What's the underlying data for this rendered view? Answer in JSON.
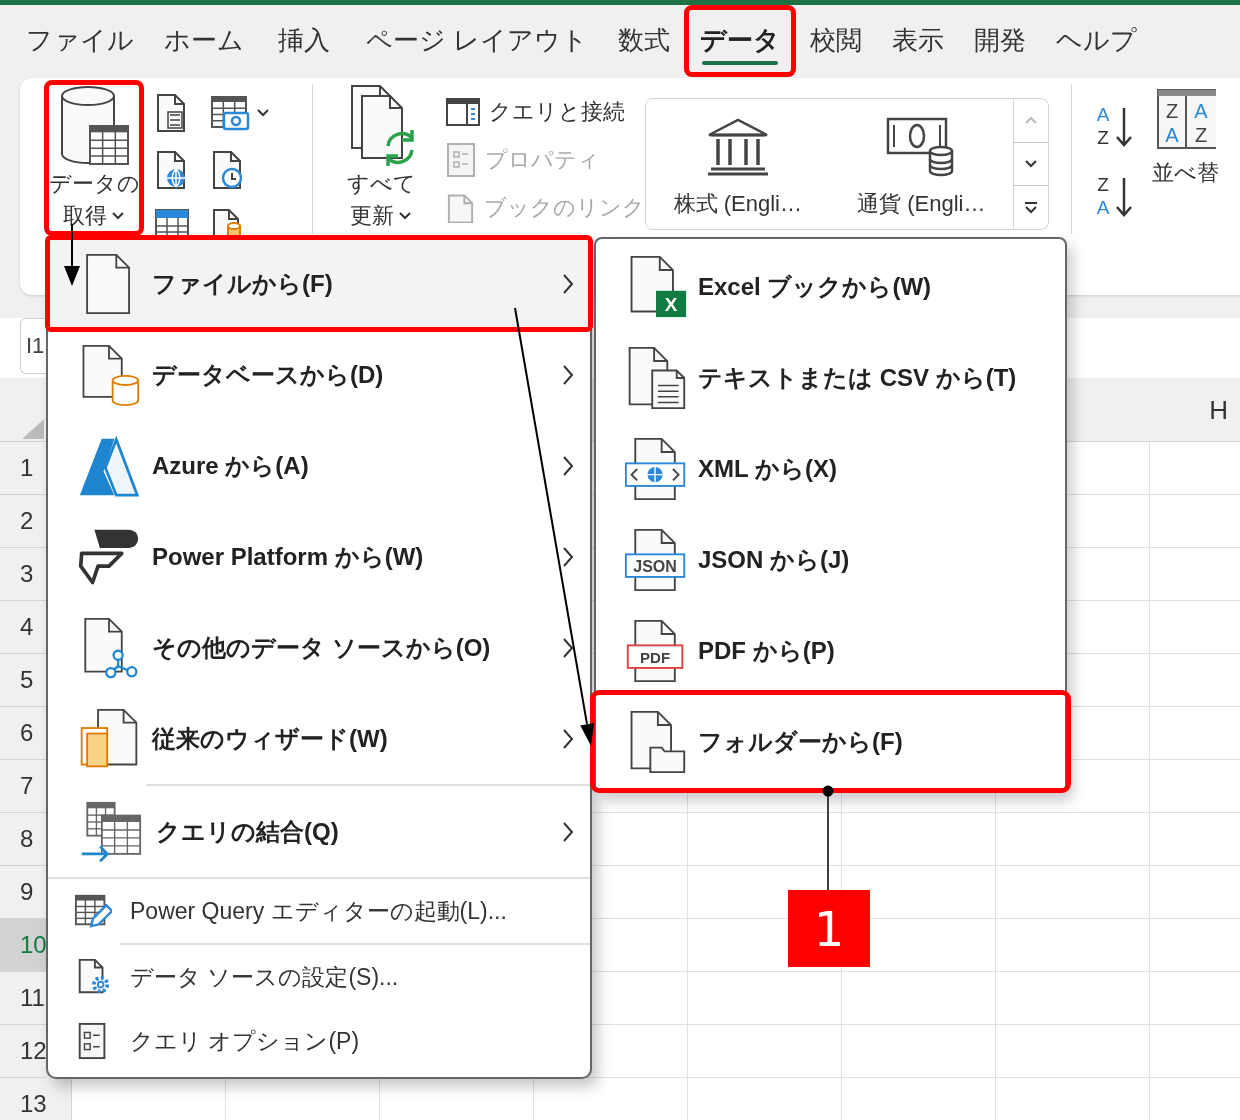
{
  "tabs": [
    {
      "label": "ファイル",
      "selected": false,
      "highlighted": false
    },
    {
      "label": "ホーム",
      "selected": false,
      "highlighted": false
    },
    {
      "label": "挿入",
      "selected": false,
      "highlighted": false
    },
    {
      "label": "ページ レイアウト",
      "selected": false,
      "highlighted": false
    },
    {
      "label": "数式",
      "selected": false,
      "highlighted": false
    },
    {
      "label": "データ",
      "selected": true,
      "highlighted": true
    },
    {
      "label": "校閲",
      "selected": false,
      "highlighted": false
    },
    {
      "label": "表示",
      "selected": false,
      "highlighted": false
    },
    {
      "label": "開発",
      "selected": false,
      "highlighted": false
    },
    {
      "label": "ヘルプ",
      "selected": false,
      "highlighted": false
    }
  ],
  "ribbon": {
    "get_data": {
      "label_lines": [
        "データの",
        "取得"
      ],
      "highlighted": true
    },
    "refresh_all": {
      "label_lines": [
        "すべて",
        "更新"
      ]
    },
    "query_commands": [
      {
        "label": "クエリと接続",
        "disabled": false
      },
      {
        "label": "プロパティ",
        "disabled": true
      },
      {
        "label": "ブックのリンク",
        "disabled": true
      }
    ],
    "data_types": [
      {
        "label": "株式 (Engli…"
      },
      {
        "label": "通貨 (Engli…"
      }
    ],
    "sort_buttons": [
      {
        "letters": [
          "A",
          "Z"
        ]
      },
      {
        "letters": [
          "Z",
          "A"
        ]
      }
    ],
    "sort": {
      "label": "並べ替",
      "icon_letters": [
        "Z",
        "A",
        "A",
        "Z"
      ]
    }
  },
  "name_box": {
    "value": "I1"
  },
  "sheet": {
    "column_headers": [
      "H"
    ],
    "rows": [
      {
        "label": "1",
        "selected": false
      },
      {
        "label": "2",
        "selected": false
      },
      {
        "label": "3",
        "selected": false
      },
      {
        "label": "4",
        "selected": false
      },
      {
        "label": "5",
        "selected": false
      },
      {
        "label": "6",
        "selected": false
      },
      {
        "label": "7",
        "selected": false
      },
      {
        "label": "8",
        "selected": false
      },
      {
        "label": "9",
        "selected": false
      },
      {
        "label": "10",
        "selected": true
      },
      {
        "label": "11",
        "selected": false
      },
      {
        "label": "12",
        "selected": false
      },
      {
        "label": "13",
        "selected": false
      }
    ]
  },
  "menu": {
    "items": [
      {
        "kind": "large",
        "label": "ファイルから(F)",
        "submenu": true,
        "selected": true,
        "highlighted": true,
        "separator_before": false
      },
      {
        "kind": "large",
        "label": "データベースから(D)",
        "submenu": true,
        "selected": false,
        "highlighted": false,
        "separator_before": false
      },
      {
        "kind": "large",
        "label": "Azure から(A)",
        "submenu": true,
        "selected": false,
        "highlighted": false,
        "separator_before": false
      },
      {
        "kind": "large",
        "label": "Power Platform から(W)",
        "submenu": true,
        "selected": false,
        "highlighted": false,
        "separator_before": false
      },
      {
        "kind": "large",
        "label": "その他のデータ ソースから(O)",
        "submenu": true,
        "selected": false,
        "highlighted": false,
        "separator_before": false
      },
      {
        "kind": "large",
        "label": "従来のウィザード(W)",
        "submenu": true,
        "selected": false,
        "highlighted": false,
        "separator_before": false
      },
      {
        "kind": "large",
        "label": "クエリの結合(Q)",
        "submenu": true,
        "selected": false,
        "highlighted": false,
        "separator_before": true
      },
      {
        "kind": "small",
        "label": "Power Query エディターの起動(L)...",
        "submenu": false,
        "selected": false,
        "highlighted": false,
        "separator_before": true
      },
      {
        "kind": "small",
        "label": "データ ソースの設定(S)...",
        "submenu": false,
        "selected": false,
        "highlighted": false,
        "separator_before": true
      },
      {
        "kind": "small",
        "label": "クエリ オプション(P)",
        "submenu": false,
        "selected": false,
        "highlighted": false,
        "separator_before": false
      }
    ]
  },
  "submenu": {
    "items": [
      {
        "label": "Excel ブックから(W)",
        "icon_text": "X",
        "highlighted": false
      },
      {
        "label": "テキストまたは CSV から(T)",
        "highlighted": false
      },
      {
        "label": "XML から(X)",
        "highlighted": false
      },
      {
        "label": "JSON から(J)",
        "icon_text": "JSON",
        "highlighted": false
      },
      {
        "label": "PDF から(P)",
        "icon_text": "PDF",
        "highlighted": false
      },
      {
        "label": "フォルダーから(F)",
        "highlighted": true
      }
    ]
  },
  "annotations": {
    "badge": "1"
  }
}
